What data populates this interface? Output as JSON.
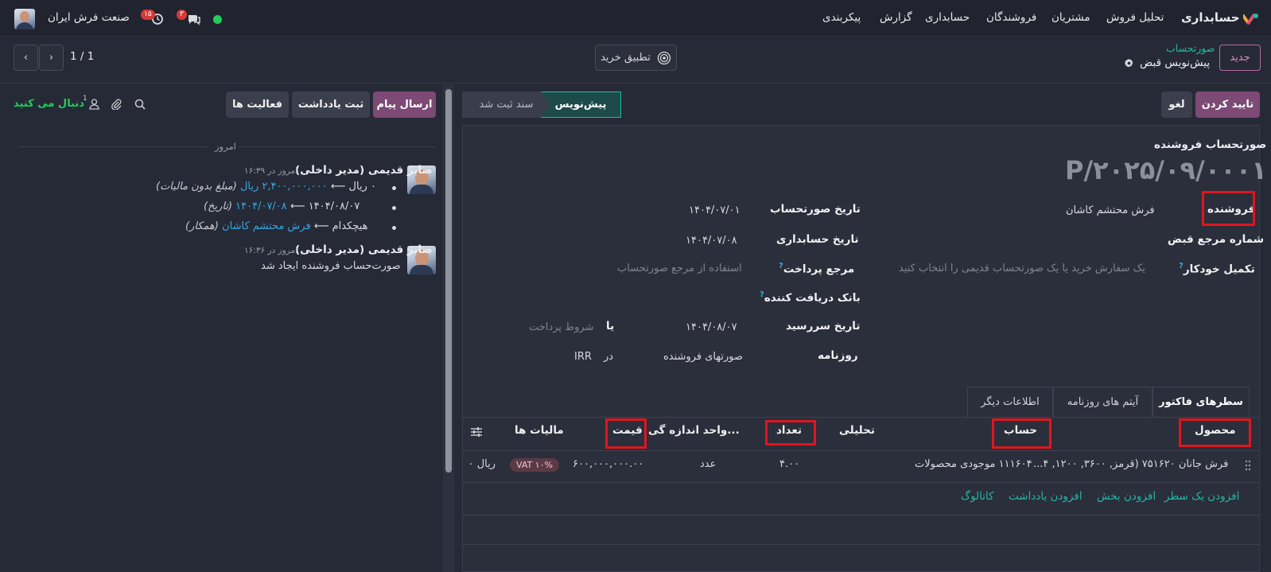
{
  "navbar": {
    "app_name": "حسابداری",
    "menu": [
      "تحلیل فروش",
      "مشتریان",
      "فروشندگان",
      "حسابداری",
      "گزارش",
      "پیکربندی"
    ],
    "company": "صنعت فرش ایران",
    "activity_badge": "۱۵",
    "messages_badge": "۳"
  },
  "control_panel": {
    "new_button": "جدید",
    "breadcrumb_parent": "صورتحساب",
    "breadcrumb_current": "پیش‌نویس قبض",
    "purchase_match": "تطبیق خرید",
    "pager": "1 / 1"
  },
  "actions": {
    "confirm": "تایید کردن",
    "cancel": "لغو"
  },
  "statusbar": {
    "draft": "پیش‌نویس",
    "posted": "سند ثبت شد"
  },
  "form": {
    "doc_type": "صورتحساب فروشنده",
    "doc_number": "P/۲۰۲۵/۰۹/۰۰۰۱",
    "vendor_label": "فروشنده",
    "vendor_value": "فرش محتشم کاشان",
    "bill_ref_label": "شماره مرجع قبض",
    "autocomplete_label": "تکمیل خودکار",
    "autocomplete_placeholder": "یک سفارش خرید یا یک صورتحساب قدیمی را انتخاب کنید",
    "bill_date_label": "تاریخ صورتحساب",
    "bill_date_value": "۱۴۰۴/۰۷/۰۱",
    "accounting_date_label": "تاریخ حسابداری",
    "accounting_date_value": "۱۴۰۴/۰۷/۰۸",
    "payment_ref_label": "مرجع پرداخت",
    "payment_ref_placeholder": "استفاده از مرجع صورتحساب",
    "recipient_bank_label": "بانک دریافت کننده",
    "due_date_label": "تاریخ سررسید",
    "due_date_value": "۱۴۰۴/۰۸/۰۷",
    "or_label": "یا",
    "payment_terms_placeholder": "شروط پرداخت",
    "journal_label": "روزنامه",
    "journal_value": "صورتهای فروشنده",
    "in_label": "در",
    "currency": "IRR"
  },
  "tabs": [
    "سطرهای فاکتور",
    "آیتم های روزنامه",
    "اطلاعات دیگر"
  ],
  "table": {
    "headers": {
      "product": "محصول",
      "account": "حساب",
      "analytic": "تحلیلی",
      "quantity": "تعداد",
      "uom": "واحد اندازه گی...",
      "price": "قیمت",
      "taxes": "مالیات ها"
    },
    "row": {
      "product": "فرش جانان ۷۵۱۶۲۰ (قرمز, ۳۶۰۰, ۱۲۰۰, ۴...",
      "account": "۱۱۱۶۰۴ موجودی محصولات",
      "quantity": "۴.۰۰",
      "uom": "عدد",
      "price": "۶۰۰,۰۰۰,۰۰۰.۰۰",
      "tax": "VAT ۱۰%",
      "subtotal": "ریال ۰"
    },
    "add_links": [
      "افزودن یک سطر",
      "افزودن بخش",
      "افزودن یادداشت",
      "کاتالوگ"
    ]
  },
  "chatter": {
    "send_message": "ارسال پیام",
    "log_note": "ثبت یادداشت",
    "activities": "فعالیت ها",
    "follow": "دنبال می کنید",
    "followers_count": "1",
    "today": "امروز",
    "messages": [
      {
        "author": "صابر قدیمی (مدیر داخلی)",
        "time": "امروز در ۱۶:۳۹",
        "changes": [
          {
            "old": "۰ ریال",
            "new": "۲,۴۰۰,۰۰۰,۰۰۰ ریال",
            "field": "(مبلغ بدون مالیات)"
          },
          {
            "old": "۱۴۰۴/۰۸/۰۷",
            "new": "۱۴۰۴/۰۷/۰۸",
            "field": "(تاریخ)"
          },
          {
            "old": "هیچکدام",
            "new": "فرش محتشم کاشان",
            "field": "(همکار)"
          }
        ]
      },
      {
        "author": "صابر قدیمی (مدیر داخلی)",
        "time": "امروز در ۱۶:۳۶",
        "body": "صورت‌حساب فروشنده ایجاد شد"
      }
    ]
  },
  "colors": {
    "accent_purple": "#7c4a74",
    "teal": "#23b7a3",
    "link_blue": "#38a6e0",
    "highlight_red": "#e0161e"
  }
}
